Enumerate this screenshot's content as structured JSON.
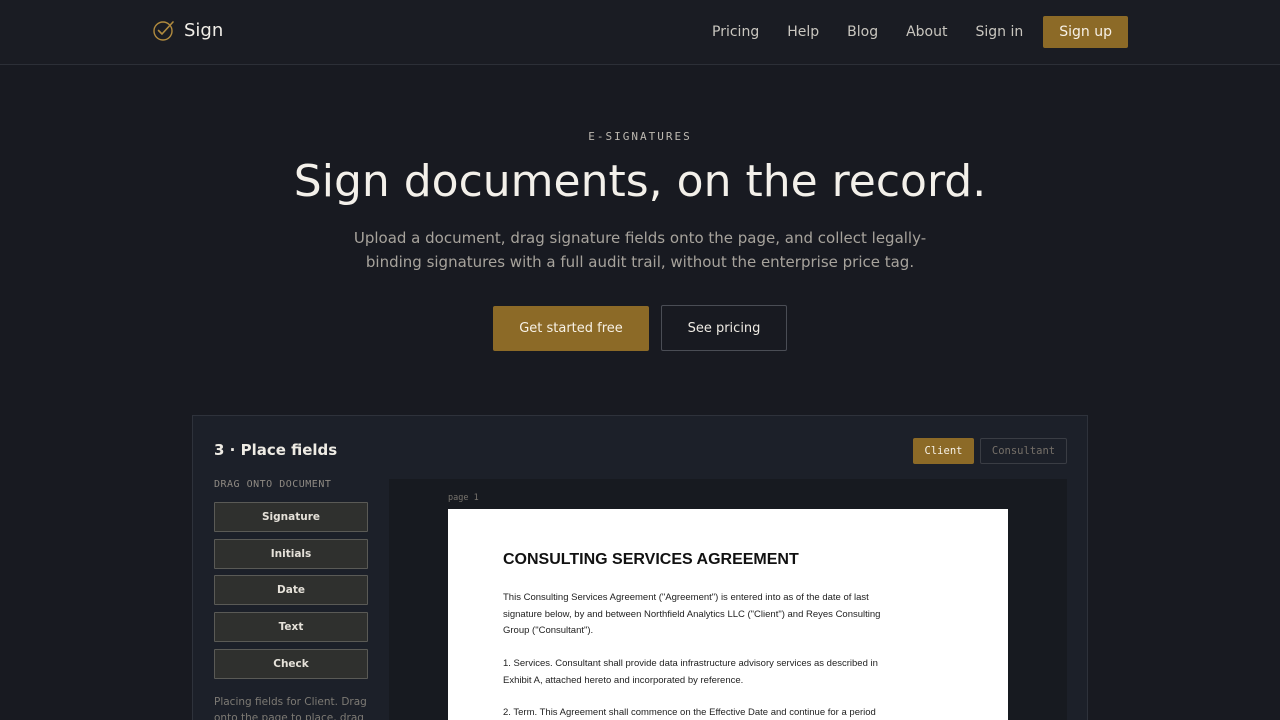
{
  "header": {
    "brand": "Sign",
    "nav": [
      "Pricing",
      "Help",
      "Blog",
      "About",
      "Sign in"
    ],
    "signup_label": "Sign up"
  },
  "hero": {
    "eyebrow": "E-SIGNATURES",
    "title": "Sign documents, on the record.",
    "subtitle": "Upload a document, drag signature fields onto the page, and collect legally-binding signatures with a full audit trail, without the enterprise price tag.",
    "cta_primary": "Get started free",
    "cta_secondary": "See pricing"
  },
  "preview": {
    "step_title": "3 · Place fields",
    "roles": [
      "Client",
      "Consultant"
    ],
    "active_role": "Client",
    "drag_heading": "DRAG ONTO DOCUMENT",
    "fields": [
      "Signature",
      "Initials",
      "Date",
      "Text",
      "Check"
    ],
    "placing_note": "Placing fields for Client. Drag onto the page to place, drag",
    "page_label": "page 1",
    "document": {
      "title": "CONSULTING SERVICES AGREEMENT",
      "paragraphs": [
        "This Consulting Services Agreement (\"Agreement\") is entered into as of the date of last signature below, by and between Northfield Analytics LLC (\"Client\") and Reyes Consulting Group (\"Consultant\").",
        "1. Services. Consultant shall provide data infrastructure advisory services as described in Exhibit A, attached hereto and incorporated by reference.",
        "2. Term. This Agreement shall commence on the Effective Date and continue for a period"
      ]
    }
  },
  "colors": {
    "background": "#181a21",
    "accent": "#8c6a27"
  }
}
